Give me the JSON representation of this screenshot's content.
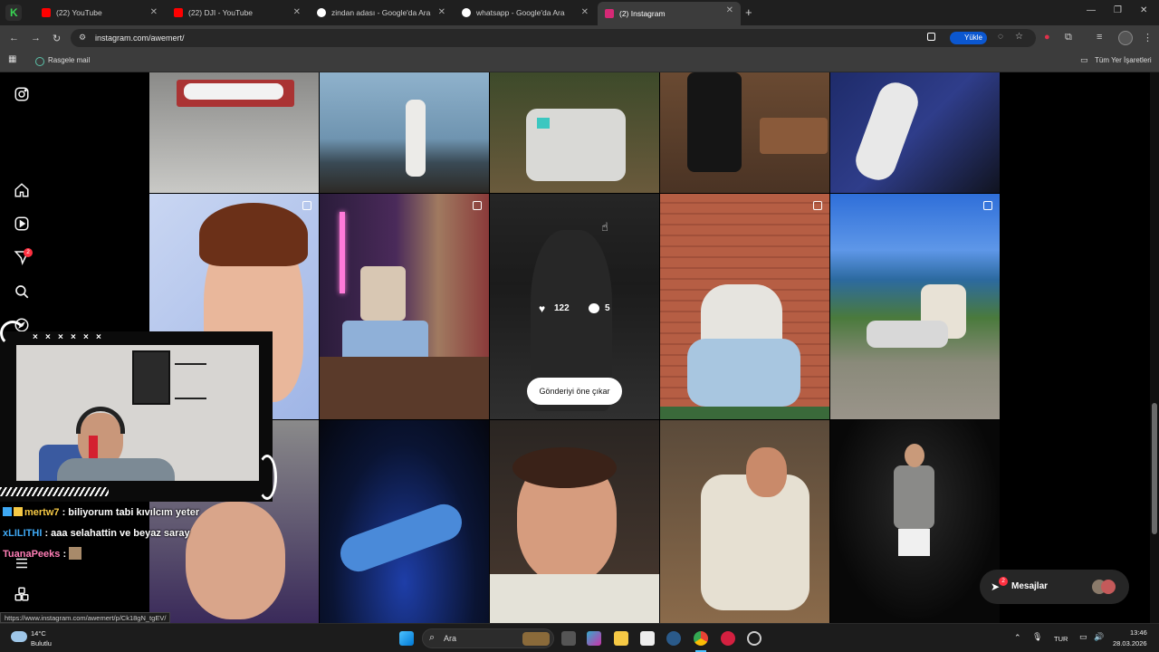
{
  "browser": {
    "tabs": [
      {
        "title": "(22) YouTube",
        "color": "#ff0000",
        "active": false
      },
      {
        "title": "(22) DJI - YouTube",
        "color": "#ff0000",
        "active": false
      },
      {
        "title": "zindan adası - Google'da Ara",
        "color": "#4285f4",
        "active": false
      },
      {
        "title": "whatsapp - Google'da Ara",
        "color": "#4285f4",
        "active": false
      },
      {
        "title": "(2) Instagram",
        "color": "#d62976",
        "active": true
      }
    ],
    "new_tab": "+",
    "url": "instagram.com/awemert/",
    "upload_label": "Yükle",
    "bookmarks": {
      "item": "Rasgele mail",
      "all": "Tüm Yer İşaretleri"
    }
  },
  "sidebar": {
    "notification_badge": "2"
  },
  "post_hover": {
    "likes": "122",
    "comments": "5",
    "pin_label": "Gönderiyi öne çıkar"
  },
  "messages": {
    "label": "Mesajlar",
    "badge": "2"
  },
  "stream": {
    "marks": [
      "×",
      "×",
      "×",
      "×",
      "×",
      "×"
    ],
    "chat": [
      {
        "user": "mertw7",
        "text": " : biliyorum tabi kıvılcım yeter",
        "color": "#f6c945"
      },
      {
        "user": "xLILITHI",
        "text": " : aaa selahattin ve beyaz saray",
        "color": "#3fa9f5"
      },
      {
        "user": "TuanaPeeks",
        "text": " : ",
        "color": "#ff7eb6"
      }
    ]
  },
  "status_url": "https://www.instagram.com/awemert/p/Ck18gN_tgEV/",
  "taskbar": {
    "weather_temp": "14°C",
    "weather_desc": "Bulutlu",
    "search_label": "Ara",
    "lang": "TUR",
    "time": "13:46",
    "date": "28.03.2026"
  }
}
